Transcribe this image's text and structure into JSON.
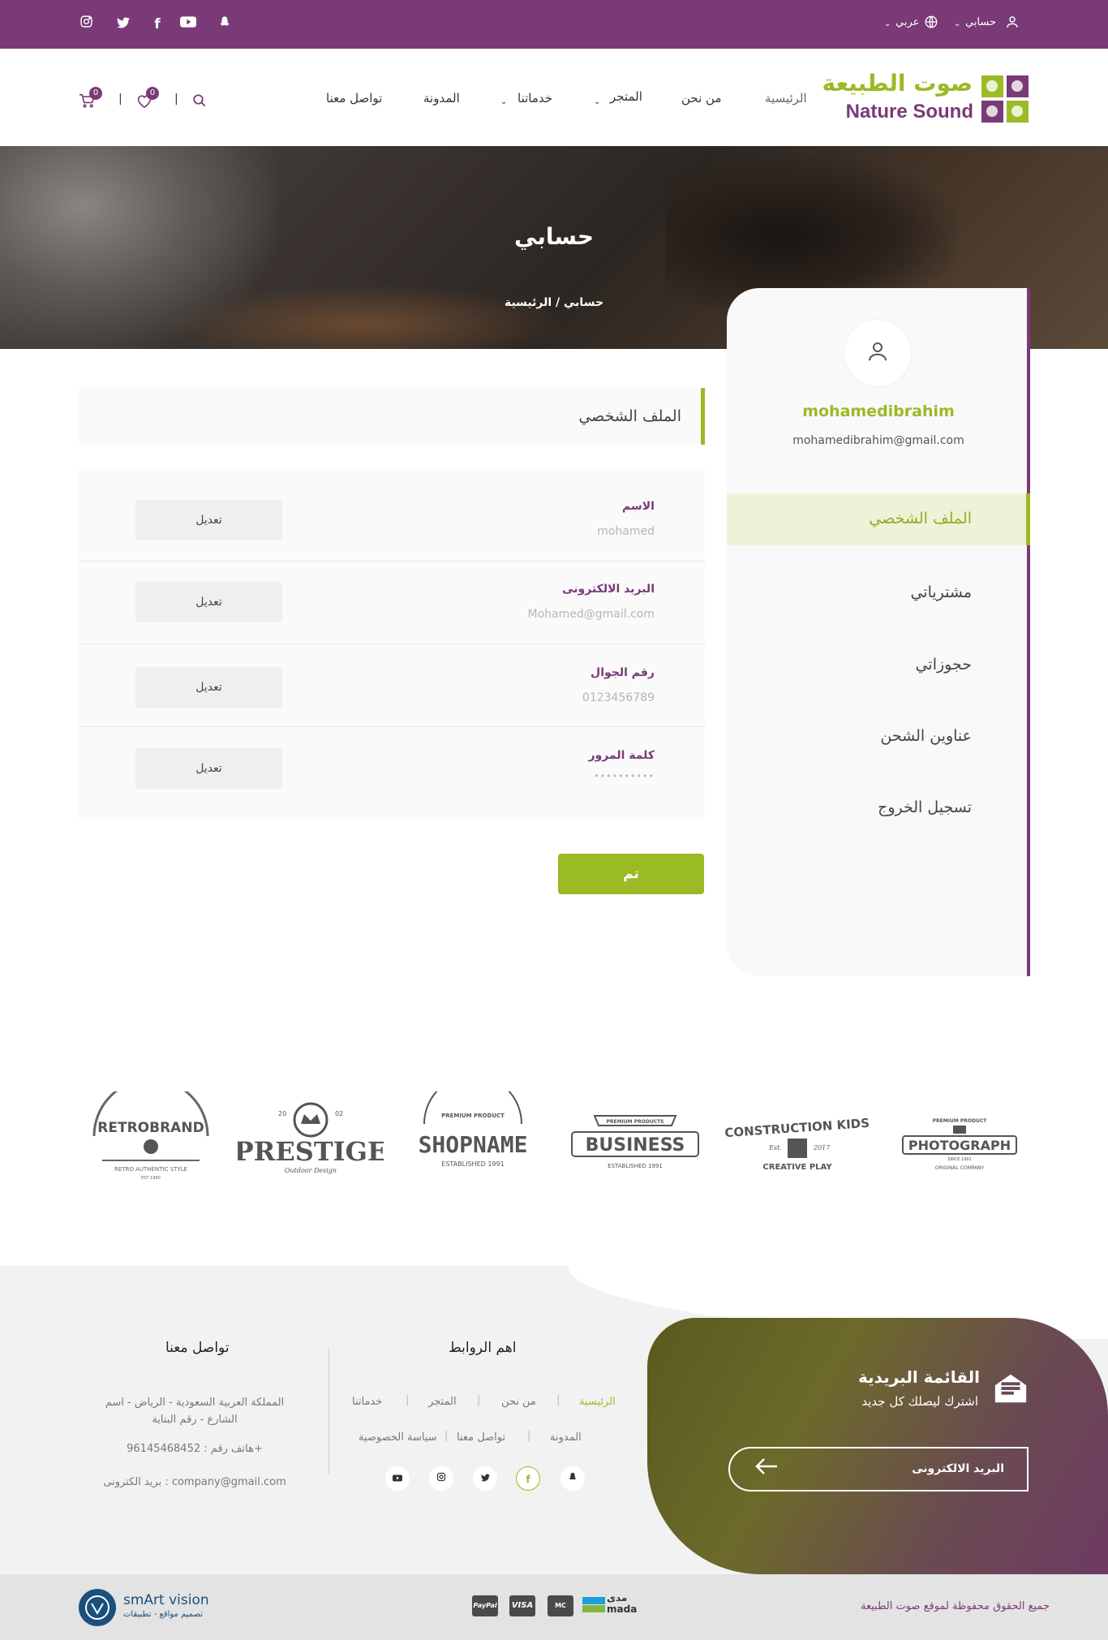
{
  "topbar": {
    "account_label": "حسابي",
    "language_label": "عربي",
    "social_icons": [
      "snapchat-icon",
      "youtube-icon",
      "facebook-icon",
      "twitter-icon",
      "instagram-icon"
    ]
  },
  "header": {
    "logo_arabic": "صوت الطبيعة",
    "logo_english": "Nature Sound",
    "nav": {
      "home": "الرئيسية",
      "about": "من نحن",
      "store": "المتجر",
      "services": "خدماتنا",
      "blog": "المدونة",
      "contact": "تواصل معنا"
    },
    "wishlist_count": "0",
    "cart_count": "0",
    "separator": "|"
  },
  "hero": {
    "title": "حسابي",
    "breadcrumb_home": "الرئيسية",
    "breadcrumb_sep": "/",
    "breadcrumb_current": "حسابي"
  },
  "sidebar": {
    "username": "mohamedibrahim",
    "email": "mohamedibrahim@gmail.com",
    "items": [
      {
        "label": "الملف الشخصي"
      },
      {
        "label": "مشترياتي"
      },
      {
        "label": "حجوزاتي"
      },
      {
        "label": "عناوين الشحن"
      },
      {
        "label": "تسجيل الخروج"
      }
    ]
  },
  "profile": {
    "title": "الملف الشخصي",
    "fields": [
      {
        "label": "الاسم",
        "value": "mohamed",
        "edit": "تعديل"
      },
      {
        "label": "البريد الالكترونى",
        "value": "Mohamed@gmail.com",
        "edit": "تعديل"
      },
      {
        "label": "رقم الجوال",
        "value": "0123456789",
        "edit": "تعديل"
      },
      {
        "label": "كلمة المرور",
        "value": "••••••••••",
        "edit": "تعديل"
      }
    ],
    "done_label": "تم"
  },
  "brands": {
    "retrobrand": {
      "name": "RETROBRAND",
      "sub": "RETRO AUTHENTIC STYLE",
      "est": "EST 1980"
    },
    "prestige": {
      "name": "PRESTIGE",
      "year_left": "20",
      "year_right": "02",
      "sub": "Outdoor Design"
    },
    "shopname": {
      "name": "SHOPNAME",
      "top": "PREMIUM PRODUCT",
      "sub": "ESTABLISHED 1991"
    },
    "business": {
      "name": "BUSINESS",
      "top": "PREMIUM PRODUCTS",
      "sub": "ESTABLISHED 1991"
    },
    "construction": {
      "name": "CONSTRUCTION KIDS",
      "est": "Est.",
      "year": "2017",
      "sub": "CREATIVE PLAY"
    },
    "photograph": {
      "name": "PHOTOGRAPH",
      "top": "PREMIUM PRODUCT",
      "since": "SINCE 1991",
      "sub": "ORIGINAL COMPANY"
    }
  },
  "newsletter": {
    "title": "القائمة البريدية",
    "subtitle": "اشترك ليصلك كل جديد",
    "placeholder": "البريد الالكترونى"
  },
  "footer": {
    "links_heading": "اهم الروابط",
    "links": {
      "home": "الرئيسية",
      "about": "من نحن",
      "store": "المتجر",
      "services": "خدماتنا",
      "blog": "المدونة",
      "contact": "تواصل معنا",
      "privacy": "سياسة الخصوصية"
    },
    "contact_heading": "تواصل معنا",
    "address": "المملكة العربية السعودية - الرياض - اسم الشارع - رقم البناية",
    "phone": "هاتف رقم : 96145468452+",
    "email": "بريد الكترونى : company@gmail.com"
  },
  "bottom": {
    "copyright": "جميع الحقوق محفوظة لموقع صوت الطبيعة",
    "payment": {
      "mada_ar": "مدى",
      "mada_en": "mada",
      "mastercard": "MC",
      "visa": "VISA",
      "paypal": "PayPal"
    },
    "developer_name": "smArt vision",
    "developer_tagline": "تصميم مواقع - تطبيقات"
  },
  "colors": {
    "purple": "#7a3a77",
    "green": "#9aba26"
  }
}
